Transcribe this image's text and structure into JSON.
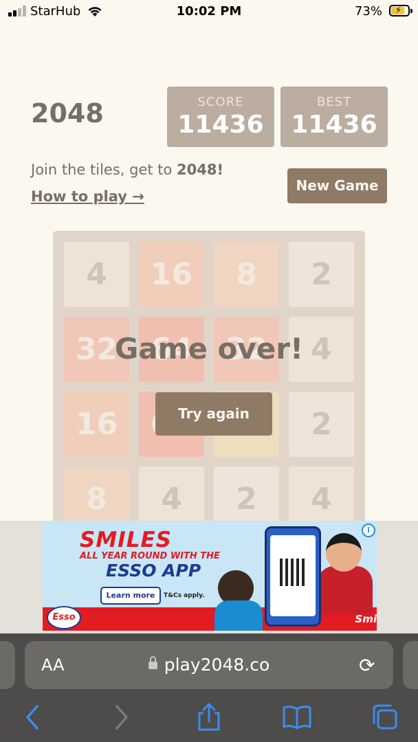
{
  "status_bar": {
    "carrier": "StarHub",
    "time": "10:02 PM",
    "battery": "73%"
  },
  "game": {
    "title": "2048",
    "score_label": "SCORE",
    "score": "11436",
    "best_label": "BEST",
    "best": "11436",
    "intro_text": "Join the tiles, get to ",
    "intro_bold": "2048!",
    "how_to": "How to play →",
    "new_game": "New Game",
    "game_over": "Game over!",
    "try_again": "Try again"
  },
  "board": [
    [
      4,
      16,
      8,
      2
    ],
    [
      32,
      64,
      32,
      4
    ],
    [
      16,
      64,
      128,
      2
    ],
    [
      8,
      4,
      2,
      4
    ]
  ],
  "ad": {
    "headline": "SMILES",
    "tagline": "ALL YEAR ROUND WITH THE",
    "app": "ESSO APP",
    "learn_more": "Learn more",
    "tc": "T&Cs apply.",
    "brand": "Esso",
    "corner_brand": "Smi",
    "info": "i"
  },
  "safari": {
    "text_size": "AA",
    "url": "play2048.co",
    "reload_icon": "⟳"
  },
  "colors": {
    "bg": "#faf8ef",
    "board": "#bbada0",
    "button": "#8f7a66",
    "t2": "#eee4da",
    "t4": "#ede0c8",
    "t8": "#f2b179",
    "t16": "#f59563",
    "t32": "#f67c5f",
    "t64": "#f65e3b",
    "t128": "#edcf72"
  }
}
